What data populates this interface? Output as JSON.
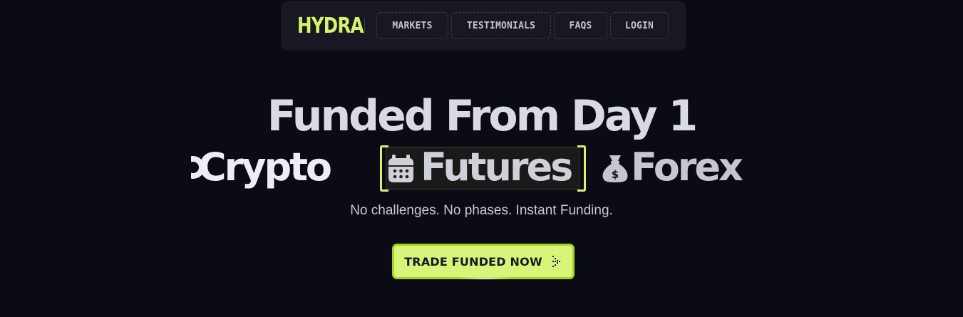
{
  "nav": {
    "logo": "HYDRA",
    "items": [
      {
        "label": "MARKETS"
      },
      {
        "label": "TESTIMONIALS"
      },
      {
        "label": "FAQS"
      },
      {
        "label": "LOGIN"
      }
    ]
  },
  "hero": {
    "title": "Funded From Day 1",
    "markets": [
      "Crypto",
      "Futures",
      "Forex"
    ],
    "subtitle": "No challenges. No phases. Instant Funding.",
    "cta_label": "TRADE FUNDED NOW"
  },
  "colors": {
    "background": "#0a0b14",
    "nav_background": "#171821",
    "accent": "#d6f36b",
    "cta_border": "#a5d321"
  },
  "icons": {
    "crypto": "bitcoin-icon",
    "futures": "calendar-icon",
    "forex": "money-bag-icon",
    "cta": "arrow-right-icon"
  }
}
